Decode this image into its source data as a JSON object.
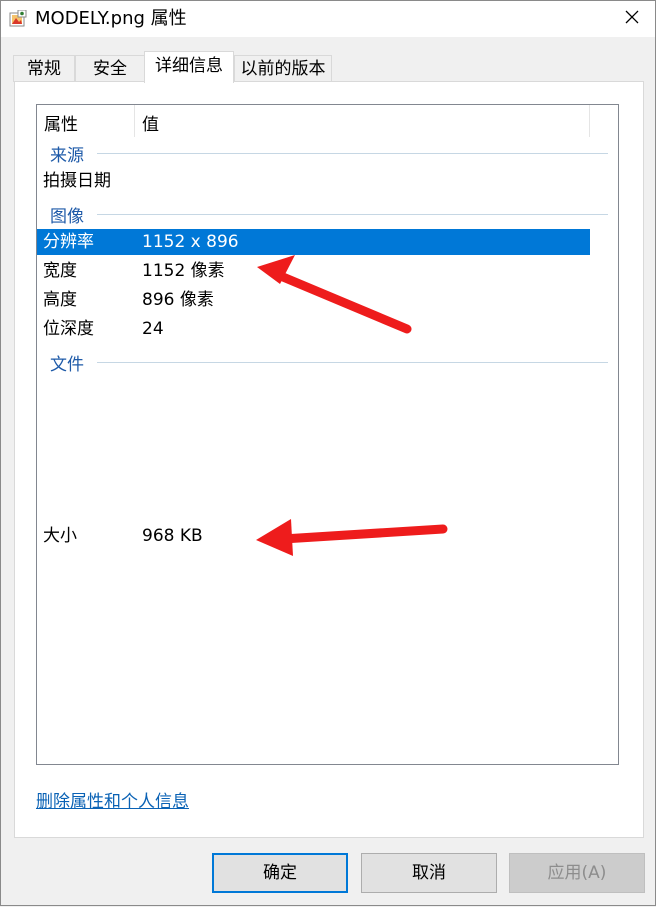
{
  "window": {
    "title": "MODELY.png 属性",
    "app_icon": "image-file-icon",
    "close_icon": "close-icon"
  },
  "tabs": [
    {
      "label": "常规",
      "active": false
    },
    {
      "label": "安全",
      "active": false
    },
    {
      "label": "详细信息",
      "active": true
    },
    {
      "label": "以前的版本",
      "active": false
    }
  ],
  "details": {
    "header_name": "属性",
    "header_value": "值",
    "groups": {
      "source": "来源",
      "image": "图像",
      "file": "文件"
    },
    "rows": {
      "date_taken": {
        "name": "拍摄日期",
        "value": ""
      },
      "resolution": {
        "name": "分辨率",
        "value": "1152 x 896"
      },
      "width": {
        "name": "宽度",
        "value": "1152 像素"
      },
      "height": {
        "name": "高度",
        "value": "896 像素"
      },
      "bit_depth": {
        "name": "位深度",
        "value": "24"
      },
      "size": {
        "name": "大小",
        "value": "968 KB"
      }
    }
  },
  "remove_link": "删除属性和个人信息",
  "buttons": {
    "ok": "确定",
    "cancel": "取消",
    "apply": "应用(A)"
  },
  "colors": {
    "selection": "#0078d7",
    "group_text": "#1e5aa8",
    "annotation_arrow": "#ee1c1c"
  }
}
